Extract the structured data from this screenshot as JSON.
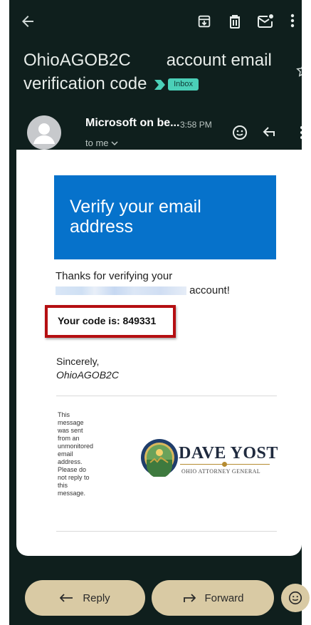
{
  "header": {
    "back_icon": "arrow-left-icon",
    "archive_icon": "archive-icon",
    "delete_icon": "trash-icon",
    "mark_unread_icon": "mark-unread-icon",
    "more_icon": "more-vert-icon"
  },
  "email": {
    "subject_part1": "OhioAGOB2C",
    "subject_part2": "account email verification code",
    "label": "Inbox",
    "sender": "Microsoft on be...",
    "time": "3:58 PM",
    "to": "to me"
  },
  "message": {
    "title": "Verify your email address",
    "thanks_line": "Thanks for verifying your",
    "thanks_end": "account!",
    "code_label": "Your code is: 849331",
    "closing": "Sincerely,",
    "signature": "OhioAGOB2C",
    "footer": "This message was sent from an unmonitored email address. Please do not reply to this message.",
    "logo_name": "DAVE YOST",
    "logo_sub": "OHIO ATTORNEY GENERAL"
  },
  "actions": {
    "reply": "Reply",
    "forward": "Forward"
  },
  "colors": {
    "background": "#0f1f1d",
    "hero": "#0672cb",
    "badge": "#4bd0b8",
    "button": "#d9caa4",
    "highlight": "#b50f12"
  }
}
